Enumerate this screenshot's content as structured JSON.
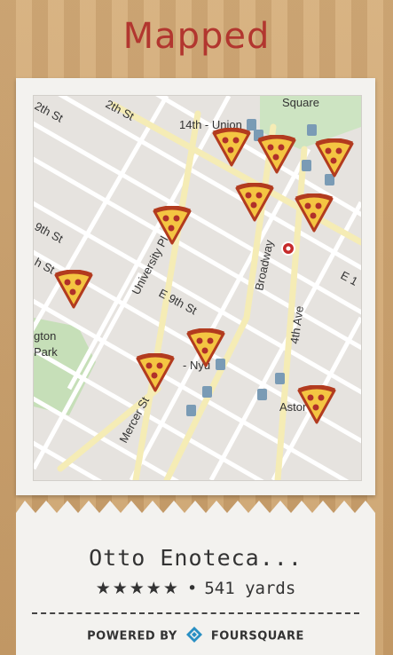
{
  "app": {
    "title": "Mapped"
  },
  "map": {
    "labels": {
      "street_12th": "2th St",
      "street_12th_2": "2th St",
      "union_square_station": "14th - Union",
      "union_sq_abbrev": "Sq",
      "union_sq_abbrev2": "Un",
      "square": "Square",
      "ninth_st_w": "9th St",
      "eighth_st_w": "h St",
      "university_pl": "University Pl",
      "e9th": "E 9th St",
      "broadway": "Broadway",
      "fourth_ave": "4th Ave",
      "e11": "E 1",
      "astor": "Astor",
      "nyu_station": "- Nyu",
      "mercer": "Mercer St",
      "washington_park_1": "gton",
      "washington_park_2": "Park"
    }
  },
  "venue": {
    "name": "Otto Enoteca...",
    "rating_stars": "★★★★★",
    "separator": "•",
    "distance": "541 yards"
  },
  "footer": {
    "powered_by": "POWERED BY",
    "brand": "FOURSQUARE"
  },
  "colors": {
    "title": "#b2362f",
    "pizza_crust": "#b23b1f",
    "pizza_cheese": "#f4c542",
    "pepperoni": "#b0302a",
    "foursquare": "#2a8fc3"
  }
}
